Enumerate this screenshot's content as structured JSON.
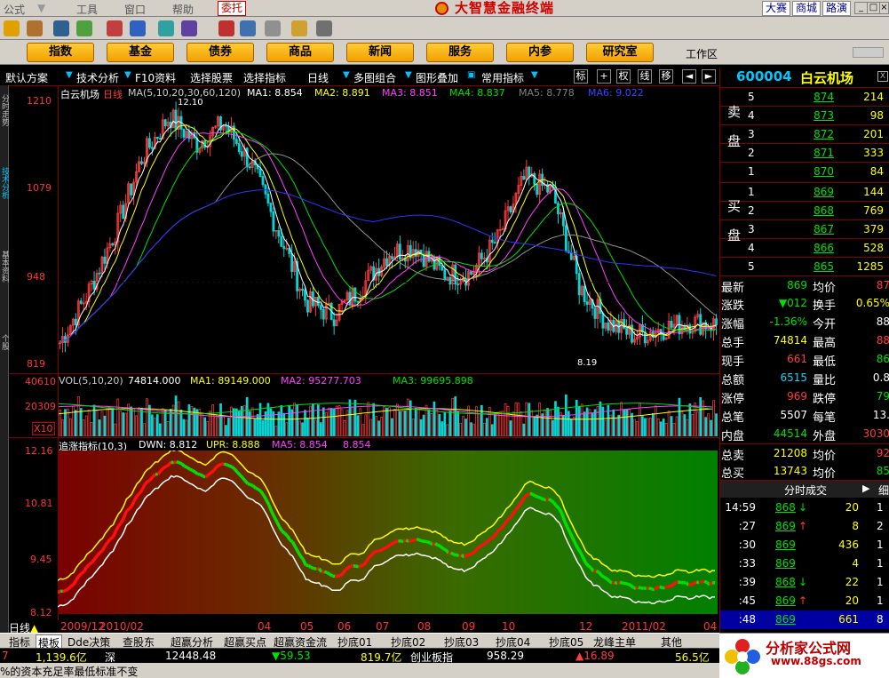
{
  "menubar": {
    "items": [
      "公式",
      "工具",
      "窗口",
      "帮助"
    ],
    "delegate": "委托",
    "title": "大智慧金融终端",
    "links": [
      "大赛",
      "商城",
      "路演"
    ],
    "win_buttons": [
      "_",
      "□",
      "×"
    ]
  },
  "nav": {
    "buttons": [
      "指数",
      "基金",
      "债券",
      "商品",
      "新闻",
      "服务",
      "内参",
      "研究室"
    ],
    "workzone": "工作区"
  },
  "tool2": {
    "items": [
      "默认方案",
      "技术分析",
      "F10资料",
      "选择股票",
      "选择指标",
      "日线",
      "多图组合",
      "图形叠加",
      "常用指标"
    ],
    "boxes": [
      "标",
      "+",
      "权",
      "线",
      "移",
      "◄",
      "►"
    ]
  },
  "sidebar": {
    "labels": [
      "分时走势",
      "技术分析",
      "基本资料",
      "个股"
    ]
  },
  "price_pane": {
    "name": "白云机场",
    "period": "日线",
    "ma_params": "MA(5,10,20,30,60,120)",
    "ma_values": [
      {
        "label": "MA1: 8.854",
        "color": "#ffffff"
      },
      {
        "label": "MA2: 8.891",
        "color": "#ffff00"
      },
      {
        "label": "MA3: 8.851",
        "color": "#ff40ff"
      },
      {
        "label": "MA4: 8.837",
        "color": "#00e000"
      },
      {
        "label": "MA5: 8.778",
        "color": "#808080"
      },
      {
        "label": "MA6: 9.022",
        "color": "#4040ff"
      }
    ],
    "y_ticks": [
      "1210",
      "1079",
      "948",
      "819"
    ],
    "high_label": "12.10",
    "low_label": "8.19"
  },
  "vol_pane": {
    "header": "VOL(5,10,20)",
    "vol": "74814.000",
    "ma1": "MA1: 89149.000",
    "ma2": "MA2: 95277.703",
    "ma3": "MA3: 99695.898",
    "y_ticks": [
      "40610",
      "20309",
      "X10"
    ]
  },
  "ind_pane": {
    "header": "追涨指标(10,3)",
    "dwn": "DWN: 8.812",
    "upr": "UPR: 8.888",
    "ma5": "MA5: 8.854",
    "ma5b": "8.854",
    "y_ticks": [
      "12.16",
      "10.81",
      "9.45",
      "8.12"
    ]
  },
  "time_axis": {
    "day_label": "日线",
    "ticks": [
      "2009/12",
      "2010/02",
      "04",
      "05",
      "06",
      "07",
      "08",
      "09",
      "10",
      "12",
      "2011/02",
      "04"
    ]
  },
  "tabs": [
    "指标",
    "模板",
    "Dde决策",
    "查股东",
    "超赢分析",
    "超赢买点",
    "超赢资金流",
    "抄底01",
    "抄底02",
    "抄底03",
    "抄底04",
    "抄底05",
    "龙峰主单",
    "其他"
  ],
  "status": {
    "items": [
      {
        "text": "7",
        "cls": "red"
      },
      {
        "text": "1,139.6亿",
        "cls": "yellow"
      },
      {
        "text": "深",
        "cls": "white"
      },
      {
        "text": "12448.48",
        "cls": "white"
      },
      {
        "text": "▼59.53",
        "cls": "green"
      },
      {
        "text": "819.7亿",
        "cls": "yellow"
      },
      {
        "text": "创业板指",
        "cls": "white"
      },
      {
        "text": "958.29",
        "cls": "white"
      },
      {
        "text": "▲16.89",
        "cls": "red"
      },
      {
        "text": "56.5亿",
        "cls": "yellow"
      }
    ]
  },
  "ticker": "%的资本充足率最低标准不变",
  "quote": {
    "code": "600004",
    "name": "白云机场",
    "asks": [
      {
        "lvl": "5",
        "px": "874",
        "vol": "214"
      },
      {
        "lvl": "4",
        "px": "873",
        "vol": "98"
      },
      {
        "lvl": "3",
        "px": "872",
        "vol": "201"
      },
      {
        "lvl": "2",
        "px": "871",
        "vol": "333"
      },
      {
        "lvl": "1",
        "px": "870",
        "vol": "84"
      }
    ],
    "bids": [
      {
        "lvl": "1",
        "px": "869",
        "vol": "144"
      },
      {
        "lvl": "2",
        "px": "868",
        "vol": "769"
      },
      {
        "lvl": "3",
        "px": "867",
        "vol": "379"
      },
      {
        "lvl": "4",
        "px": "866",
        "vol": "528"
      },
      {
        "lvl": "5",
        "px": "865",
        "vol": "1285"
      }
    ],
    "ask_label": "卖盘",
    "bid_label": "买盘",
    "stats": [
      {
        "l1": "最新",
        "v1": "869",
        "c1": "green",
        "l2": "均价",
        "v2": "87",
        "c2": "red"
      },
      {
        "l1": "涨跌",
        "v1": "▼012",
        "c1": "green",
        "l2": "换手",
        "v2": "0.65%",
        "c2": "yellow"
      },
      {
        "l1": "涨幅",
        "v1": "-1.36%",
        "c1": "green",
        "l2": "今开",
        "v2": "88",
        "c2": "white"
      },
      {
        "l1": "总手",
        "v1": "74814",
        "c1": "yellow",
        "l2": "最高",
        "v2": "88",
        "c2": "red"
      },
      {
        "l1": "现手",
        "v1": "661",
        "c1": "red",
        "l2": "最低",
        "v2": "86",
        "c2": "green"
      },
      {
        "l1": "总额",
        "v1": "6515",
        "c1": "cyan",
        "l2": "量比",
        "v2": "0.8",
        "c2": "white"
      },
      {
        "l1": "涨停",
        "v1": "969",
        "c1": "red",
        "l2": "跌停",
        "v2": "79",
        "c2": "green"
      },
      {
        "l1": "总笔",
        "v1": "5507",
        "c1": "white",
        "l2": "每笔",
        "v2": "13.",
        "c2": "white"
      },
      {
        "l1": "内盘",
        "v1": "44514",
        "c1": "green",
        "l2": "外盘",
        "v2": "3030",
        "c2": "red"
      },
      {
        "l1": "总卖",
        "v1": "21208",
        "c1": "yellow",
        "l2": "均价",
        "v2": "92",
        "c2": "red"
      },
      {
        "l1": "总买",
        "v1": "13743",
        "c1": "yellow",
        "l2": "均价",
        "v2": "85",
        "c2": "green"
      }
    ],
    "ticks_title": "分时成交",
    "ticks_detail": "细",
    "ticks": [
      {
        "t": "14:59",
        "p": "868",
        "dir": "↓",
        "vol": "20",
        "f": "1"
      },
      {
        "t": ":27",
        "p": "869",
        "dir": "↑",
        "vol": "8",
        "f": "2"
      },
      {
        "t": ":30",
        "p": "869",
        "dir": "",
        "vol": "436",
        "f": "1"
      },
      {
        "t": ":33",
        "p": "869",
        "dir": "",
        "vol": "4",
        "f": "1"
      },
      {
        "t": ":39",
        "p": "868",
        "dir": "↓",
        "vol": "22",
        "f": "1"
      },
      {
        "t": ":45",
        "p": "869",
        "dir": "↑",
        "vol": "20",
        "f": "1"
      },
      {
        "t": ":48",
        "p": "869",
        "dir": "",
        "vol": "661",
        "f": "8"
      }
    ]
  },
  "brand": {
    "name": "分析家公式网",
    "url": "www.88gs.com"
  },
  "chart_data": {
    "type": "line",
    "title": "白云机场 日线",
    "x": [
      "2009/12",
      "2010/02",
      "04",
      "05",
      "06",
      "07",
      "08",
      "09",
      "10",
      "12",
      "2011/02",
      "04"
    ],
    "close": [
      8.6,
      9.3,
      10.2,
      11.3,
      11.9,
      11.5,
      11.8,
      11.2,
      10.2,
      9.2,
      9.0,
      9.4,
      9.9,
      10.0,
      9.6,
      9.6,
      10.1,
      11.0,
      10.8,
      9.4,
      8.9,
      8.7,
      8.8,
      8.9,
      8.86
    ],
    "ylim": [
      8.19,
      12.16
    ],
    "high": 12.1,
    "low": 8.19
  }
}
